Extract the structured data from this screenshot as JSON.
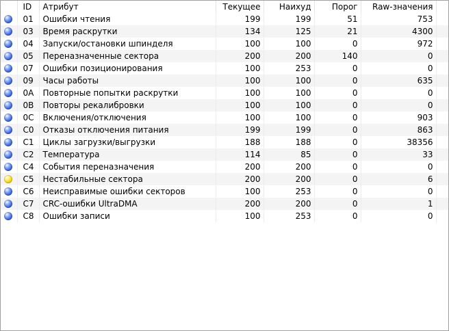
{
  "columns": {
    "id": "ID",
    "attribute": "Атрибут",
    "current": "Текущее",
    "worst": "Наихуд",
    "threshold": "Порог",
    "raw": "Raw-значения"
  },
  "rows": [
    {
      "status": "blue",
      "id": "01",
      "attribute": "Ошибки чтения",
      "current": "199",
      "worst": "199",
      "threshold": "51",
      "raw": "753"
    },
    {
      "status": "blue",
      "id": "03",
      "attribute": "Время раскрутки",
      "current": "134",
      "worst": "125",
      "threshold": "21",
      "raw": "4300"
    },
    {
      "status": "blue",
      "id": "04",
      "attribute": "Запуски/остановки шпинделя",
      "current": "100",
      "worst": "100",
      "threshold": "0",
      "raw": "972"
    },
    {
      "status": "blue",
      "id": "05",
      "attribute": "Переназначенные сектора",
      "current": "200",
      "worst": "200",
      "threshold": "140",
      "raw": "0"
    },
    {
      "status": "blue",
      "id": "07",
      "attribute": "Ошибки позиционирования",
      "current": "100",
      "worst": "253",
      "threshold": "0",
      "raw": "0"
    },
    {
      "status": "blue",
      "id": "09",
      "attribute": "Часы работы",
      "current": "100",
      "worst": "100",
      "threshold": "0",
      "raw": "635"
    },
    {
      "status": "blue",
      "id": "0A",
      "attribute": "Повторные попытки раскрутки",
      "current": "100",
      "worst": "100",
      "threshold": "0",
      "raw": "0"
    },
    {
      "status": "blue",
      "id": "0B",
      "attribute": "Повторы рекалибровки",
      "current": "100",
      "worst": "100",
      "threshold": "0",
      "raw": "0"
    },
    {
      "status": "blue",
      "id": "0C",
      "attribute": "Включения/отключения",
      "current": "100",
      "worst": "100",
      "threshold": "0",
      "raw": "903"
    },
    {
      "status": "blue",
      "id": "C0",
      "attribute": "Отказы отключения питания",
      "current": "199",
      "worst": "199",
      "threshold": "0",
      "raw": "863"
    },
    {
      "status": "blue",
      "id": "C1",
      "attribute": "Циклы загрузки/выгрузки",
      "current": "188",
      "worst": "188",
      "threshold": "0",
      "raw": "38356"
    },
    {
      "status": "blue",
      "id": "C2",
      "attribute": "Температура",
      "current": "114",
      "worst": "85",
      "threshold": "0",
      "raw": "33"
    },
    {
      "status": "blue",
      "id": "C4",
      "attribute": "События переназначения",
      "current": "200",
      "worst": "200",
      "threshold": "0",
      "raw": "0"
    },
    {
      "status": "yellow",
      "id": "C5",
      "attribute": "Нестабильные сектора",
      "current": "200",
      "worst": "200",
      "threshold": "0",
      "raw": "6"
    },
    {
      "status": "blue",
      "id": "C6",
      "attribute": "Неисправимые ошибки секторов",
      "current": "100",
      "worst": "253",
      "threshold": "0",
      "raw": "0"
    },
    {
      "status": "blue",
      "id": "C7",
      "attribute": "CRC-ошибки UltraDMA",
      "current": "200",
      "worst": "200",
      "threshold": "0",
      "raw": "1"
    },
    {
      "status": "blue",
      "id": "C8",
      "attribute": "Ошибки записи",
      "current": "100",
      "worst": "253",
      "threshold": "0",
      "raw": "0"
    }
  ]
}
